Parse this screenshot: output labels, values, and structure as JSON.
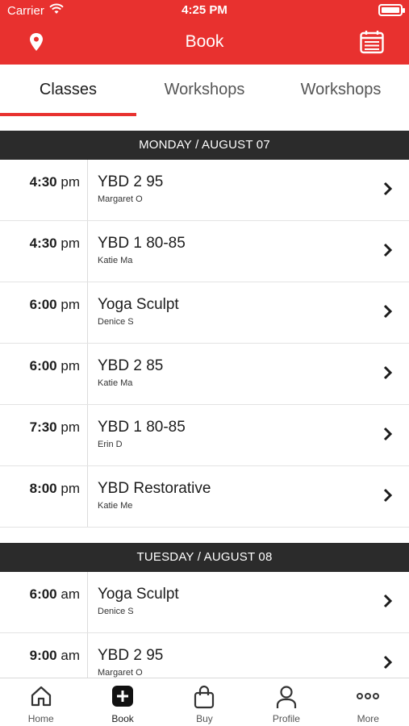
{
  "status_bar": {
    "carrier": "Carrier",
    "time": "4:25 PM"
  },
  "nav": {
    "title": "Book",
    "left_icon": "location-pin-icon",
    "right_icon": "calendar-icon"
  },
  "tabs": [
    {
      "label": "Classes",
      "active": true
    },
    {
      "label": "Workshops",
      "active": false
    },
    {
      "label": "Workshops",
      "active": false
    }
  ],
  "sections": [
    {
      "header": "MONDAY / AUGUST 07",
      "rows": [
        {
          "time": "4:30",
          "ampm": "pm",
          "name": "YBD 2 95",
          "instructor": "Margaret O"
        },
        {
          "time": "4:30",
          "ampm": "pm",
          "name": "YBD 1 80-85",
          "instructor": "Katie Ma"
        },
        {
          "time": "6:00",
          "ampm": "pm",
          "name": "Yoga Sculpt",
          "instructor": "Denice S"
        },
        {
          "time": "6:00",
          "ampm": "pm",
          "name": "YBD 2 85",
          "instructor": "Katie Ma"
        },
        {
          "time": "7:30",
          "ampm": "pm",
          "name": "YBD 1 80-85",
          "instructor": "Erin D"
        },
        {
          "time": "8:00",
          "ampm": "pm",
          "name": "YBD Restorative",
          "instructor": "Katie Me"
        }
      ]
    },
    {
      "header": "TUESDAY / AUGUST 08",
      "rows": [
        {
          "time": "6:00",
          "ampm": "am",
          "name": "Yoga Sculpt",
          "instructor": "Denice S"
        },
        {
          "time": "9:00",
          "ampm": "am",
          "name": "YBD 2 95",
          "instructor": "Margaret O"
        }
      ]
    }
  ],
  "bottom_nav": [
    {
      "label": "Home",
      "icon": "home-icon",
      "active": false
    },
    {
      "label": "Book",
      "icon": "plus-square-icon",
      "active": true
    },
    {
      "label": "Buy",
      "icon": "shopping-bag-icon",
      "active": false
    },
    {
      "label": "Profile",
      "icon": "person-icon",
      "active": false
    },
    {
      "label": "More",
      "icon": "ellipsis-icon",
      "active": false
    }
  ],
  "colors": {
    "brand": "#e8312f",
    "section_header": "#2b2b2b"
  }
}
